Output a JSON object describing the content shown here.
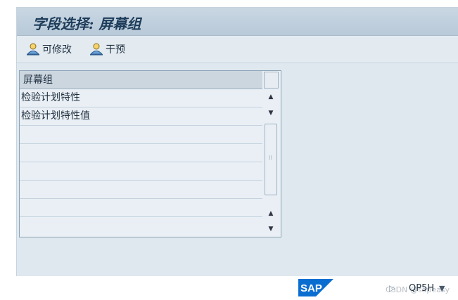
{
  "window": {
    "title": "字段选择: 屏幕组"
  },
  "toolbar": {
    "modifiable_label": "可修改",
    "intervene_label": "干预"
  },
  "table": {
    "header": "屏幕组",
    "rows": [
      "检验计划特性",
      "检验计划特性值",
      "",
      "",
      "",
      "",
      ""
    ]
  },
  "status_bar": {
    "system": "QP5H",
    "watermark": "CSDN @sapeasy"
  },
  "colors": {
    "title_bar": "#c9d7e3",
    "frame_bg": "#dfe8ef",
    "sap_blue": "#0a6ed1"
  }
}
